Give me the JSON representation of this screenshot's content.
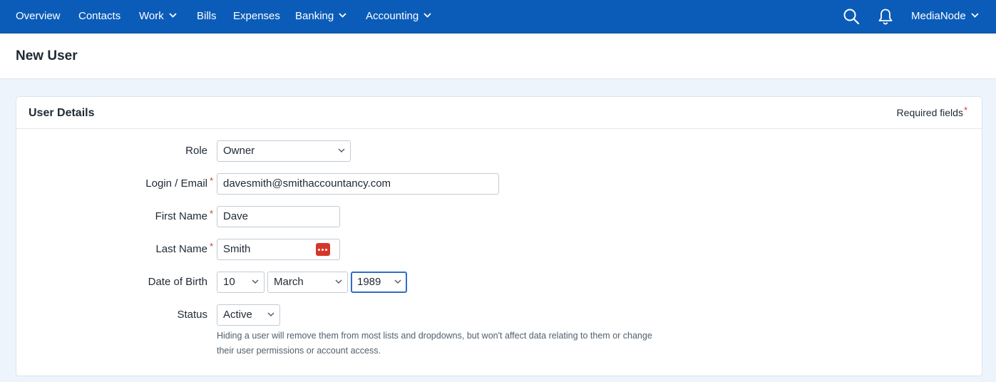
{
  "nav": {
    "items": [
      {
        "label": "Overview"
      },
      {
        "label": "Contacts"
      },
      {
        "label": "Work"
      },
      {
        "label": "Bills"
      },
      {
        "label": "Expenses"
      },
      {
        "label": "Banking"
      },
      {
        "label": "Accounting"
      }
    ],
    "account_label": "MediaNode",
    "icons": [
      "search-icon",
      "bell-icon"
    ]
  },
  "page": {
    "title": "New User"
  },
  "card": {
    "title": "User Details",
    "required_note": "Required fields",
    "required_marker": "*"
  },
  "form": {
    "role": {
      "label": "Role",
      "value": "Owner"
    },
    "email": {
      "label": "Login / Email",
      "value": "davesmith@smithaccountancy.com",
      "required": true
    },
    "first_name": {
      "label": "First Name",
      "value": "Dave",
      "required": true
    },
    "last_name": {
      "label": "Last Name",
      "value": "Smith",
      "required": true
    },
    "dob": {
      "label": "Date of Birth",
      "day": "10",
      "month": "March",
      "year": "1989"
    },
    "status": {
      "label": "Status",
      "value": "Active",
      "help": "Hiding a user will remove them from most lists and dropdowns, but won't affect data relating to them or change their user permissions or account access."
    }
  },
  "colors": {
    "nav_bg": "#0b5cb8",
    "required": "#d33a2c",
    "focus": "#2d6fc4",
    "password_manager": "#d6362a"
  }
}
